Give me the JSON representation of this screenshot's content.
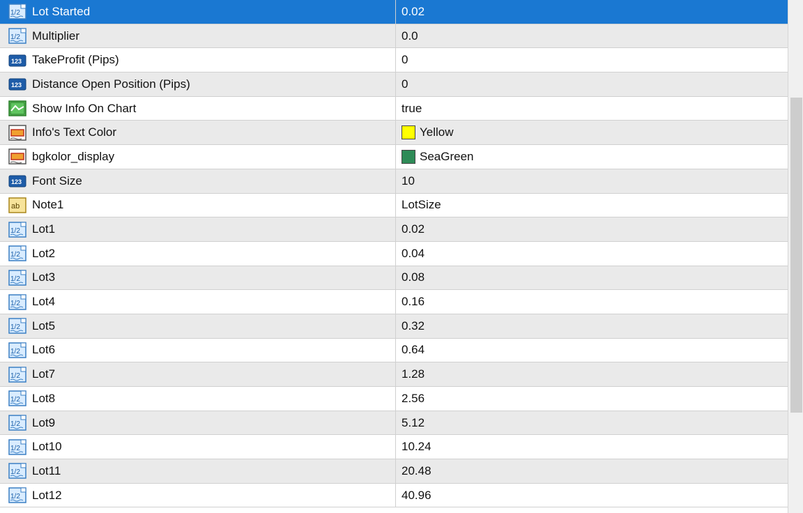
{
  "rows": [
    {
      "name": "Lot Started",
      "value": "0.02",
      "icon": "fraction-icon",
      "selected": true
    },
    {
      "name": "Multiplier",
      "value": "0.0",
      "icon": "fraction-icon"
    },
    {
      "name": "TakeProfit (Pips)",
      "value": "0",
      "icon": "integer-icon"
    },
    {
      "name": "Distance Open Position (Pips)",
      "value": "0",
      "icon": "integer-icon"
    },
    {
      "name": "Show Info On Chart",
      "value": "true",
      "icon": "boolean-icon"
    },
    {
      "name": "Info's Text Color",
      "value": "Yellow",
      "icon": "color-icon",
      "swatch": "#ffff00"
    },
    {
      "name": "bgkolor_display",
      "value": "SeaGreen",
      "icon": "color-icon",
      "swatch": "#2e8b57"
    },
    {
      "name": "Font Size",
      "value": "10",
      "icon": "integer-icon"
    },
    {
      "name": "Note1",
      "value": "LotSize",
      "icon": "string-icon"
    },
    {
      "name": "Lot1",
      "value": "0.02",
      "icon": "fraction-icon"
    },
    {
      "name": "Lot2",
      "value": "0.04",
      "icon": "fraction-icon"
    },
    {
      "name": "Lot3",
      "value": "0.08",
      "icon": "fraction-icon"
    },
    {
      "name": "Lot4",
      "value": "0.16",
      "icon": "fraction-icon"
    },
    {
      "name": "Lot5",
      "value": "0.32",
      "icon": "fraction-icon"
    },
    {
      "name": "Lot6",
      "value": "0.64",
      "icon": "fraction-icon"
    },
    {
      "name": "Lot7",
      "value": "1.28",
      "icon": "fraction-icon"
    },
    {
      "name": "Lot8",
      "value": "2.56",
      "icon": "fraction-icon"
    },
    {
      "name": "Lot9",
      "value": "5.12",
      "icon": "fraction-icon"
    },
    {
      "name": "Lot10",
      "value": "10.24",
      "icon": "fraction-icon"
    },
    {
      "name": "Lot11",
      "value": "20.48",
      "icon": "fraction-icon"
    },
    {
      "name": "Lot12",
      "value": "40.96",
      "icon": "fraction-icon"
    }
  ],
  "colors": {
    "selection": "#1a78d2",
    "row_alt": "#eaeaea"
  }
}
